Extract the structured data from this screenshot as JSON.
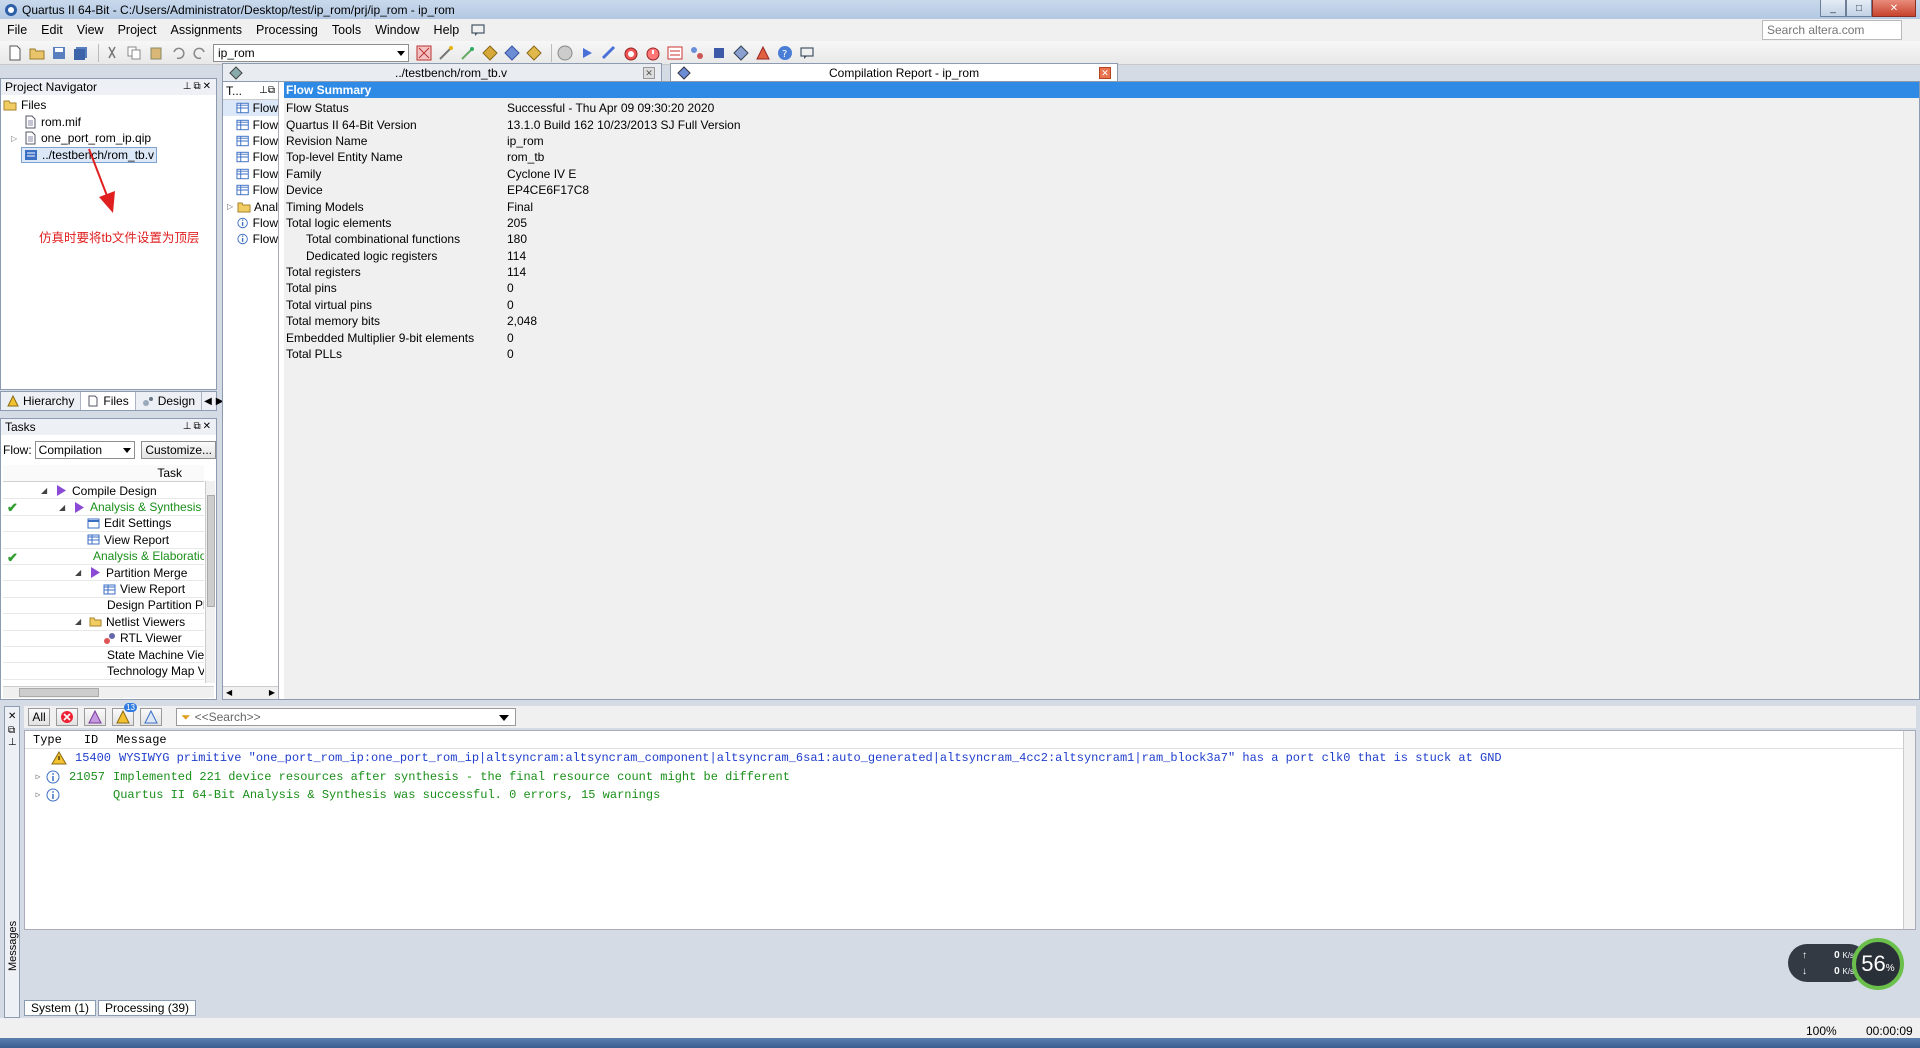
{
  "window": {
    "title": "Quartus II 64-Bit - C:/Users/Administrator/Desktop/test/ip_rom/prj/ip_rom - ip_rom"
  },
  "menu": [
    "File",
    "Edit",
    "View",
    "Project",
    "Assignments",
    "Processing",
    "Tools",
    "Window",
    "Help"
  ],
  "search": {
    "placeholder": "Search altera.com"
  },
  "toolbar": {
    "revision": "ip_rom"
  },
  "project_navigator": {
    "title": "Project Navigator",
    "root": "Files",
    "files": [
      "rom.mif",
      "one_port_rom_ip.qip",
      "../testbench/rom_tb.v"
    ],
    "annotation": "仿真时要将tb文件设置为顶层",
    "tabs": [
      "Hierarchy",
      "Files",
      "Design"
    ]
  },
  "tasks": {
    "title": "Tasks",
    "flow_label": "Flow:",
    "flow_value": "Compilation",
    "customize_label": "Customize...",
    "column_header": "Task",
    "rows": [
      {
        "label": "Compile Design",
        "done": false
      },
      {
        "label": "Analysis & Synthesis",
        "done": true
      },
      {
        "label": "Edit Settings",
        "done": false
      },
      {
        "label": "View Report",
        "done": false
      },
      {
        "label": "Analysis & Elaboration",
        "done": true
      },
      {
        "label": "Partition Merge",
        "done": false
      },
      {
        "label": "View Report",
        "done": false
      },
      {
        "label": "Design Partition Pl",
        "done": false
      },
      {
        "label": "Netlist Viewers",
        "done": false
      },
      {
        "label": "RTL Viewer",
        "done": false
      },
      {
        "label": "State Machine Vie",
        "done": false
      },
      {
        "label": "Technology Map V",
        "done": false
      }
    ]
  },
  "doc_tabs": [
    {
      "label": "../testbench/rom_tb.v"
    },
    {
      "label": "Compilation Report - ip_rom"
    }
  ],
  "toc": {
    "title": "T...",
    "items": [
      "Flow",
      "Flow",
      "Flow",
      "Flow",
      "Flow",
      "Flow",
      "Anal",
      "Flow",
      "Flow"
    ]
  },
  "flow_summary": {
    "title": "Flow Summary",
    "rows": [
      {
        "key": "Flow Status",
        "value": "Successful - Thu Apr 09 09:30:20 2020"
      },
      {
        "key": "Quartus II 64-Bit Version",
        "value": "13.1.0 Build 162 10/23/2013 SJ Full Version"
      },
      {
        "key": "Revision Name",
        "value": "ip_rom"
      },
      {
        "key": "Top-level Entity Name",
        "value": "rom_tb"
      },
      {
        "key": "Family",
        "value": "Cyclone IV E"
      },
      {
        "key": "Device",
        "value": "EP4CE6F17C8"
      },
      {
        "key": "Timing Models",
        "value": "Final"
      },
      {
        "key": "Total logic elements",
        "value": "205"
      },
      {
        "key": "Total combinational functions",
        "value": "180"
      },
      {
        "key": "Dedicated logic registers",
        "value": "114"
      },
      {
        "key": "Total registers",
        "value": "114"
      },
      {
        "key": "Total pins",
        "value": "0"
      },
      {
        "key": "Total virtual pins",
        "value": "0"
      },
      {
        "key": "Total memory bits",
        "value": "2,048"
      },
      {
        "key": "Embedded Multiplier 9-bit elements",
        "value": "0"
      },
      {
        "key": "Total PLLs",
        "value": "0"
      }
    ]
  },
  "messages": {
    "filter_all": "All",
    "warning_count": "13",
    "search_placeholder": "<<Search>>",
    "headers": {
      "type": "Type",
      "id": "ID",
      "message": "Message"
    },
    "rows": [
      {
        "kind": "warning",
        "id": "15400",
        "text": "WYSIWYG primitive \"one_port_rom_ip:one_port_rom_ip|altsyncram:altsyncram_component|altsyncram_6sa1:auto_generated|altsyncram_4cc2:altsyncram1|ram_block3a7\" has a port clk0 that is stuck at GND"
      },
      {
        "kind": "info",
        "id": "21057",
        "text": "Implemented 221 device resources after synthesis - the final resource count might be different"
      },
      {
        "kind": "info",
        "id": "",
        "text": "Quartus II 64-Bit Analysis & Synthesis was successful. 0 errors, 15 warnings"
      }
    ],
    "side_label": "Messages",
    "bottom_tabs": [
      "System (1)",
      "Processing (39)"
    ]
  },
  "netmon": {
    "up": "0",
    "down": "0",
    "unit": "K/s",
    "percent": "56",
    "percent_unit": "%"
  },
  "status": {
    "zoom": "100%",
    "elapsed": "00:00:09"
  }
}
